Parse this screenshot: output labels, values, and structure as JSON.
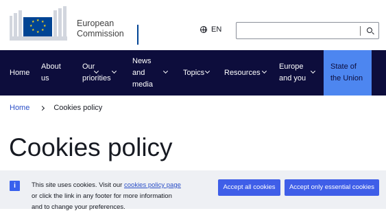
{
  "logo": {
    "line1": "European",
    "line2": "Commission"
  },
  "language": {
    "icon": "globe-icon",
    "code": "EN"
  },
  "search": {
    "value": "",
    "icon": "search-icon"
  },
  "nav": {
    "items": [
      {
        "line1": "Home",
        "line2": "",
        "line3": ""
      },
      {
        "line1": "About",
        "line2": "us",
        "line3": ""
      },
      {
        "line1": "Our",
        "line2": "priorities",
        "line3": ""
      },
      {
        "line1": "News",
        "line2": "and",
        "line3": "media"
      },
      {
        "line1": "Topics",
        "line2": "",
        "line3": ""
      },
      {
        "line1": "Resources",
        "line2": "",
        "line3": ""
      },
      {
        "line1": "Europe",
        "line2": "and you",
        "line3": ""
      },
      {
        "line1": "State of",
        "line2": "the Union",
        "line3": ""
      }
    ],
    "colors": {
      "background": "#0d0d3c",
      "active": "#4d86f0"
    }
  },
  "breadcrumb": {
    "home": "Home",
    "current": "Cookies policy"
  },
  "page": {
    "title": "Cookies policy"
  },
  "cookie_banner": {
    "icon_glyph": "i",
    "text_before_link": "This site uses cookies. Visit our ",
    "link_text": "cookies policy page",
    "line2": "or click the link in any footer for more information",
    "line3": "and to change your preferences.",
    "accept_all": "Accept all cookies",
    "accept_essential": "Accept only essential cookies"
  }
}
